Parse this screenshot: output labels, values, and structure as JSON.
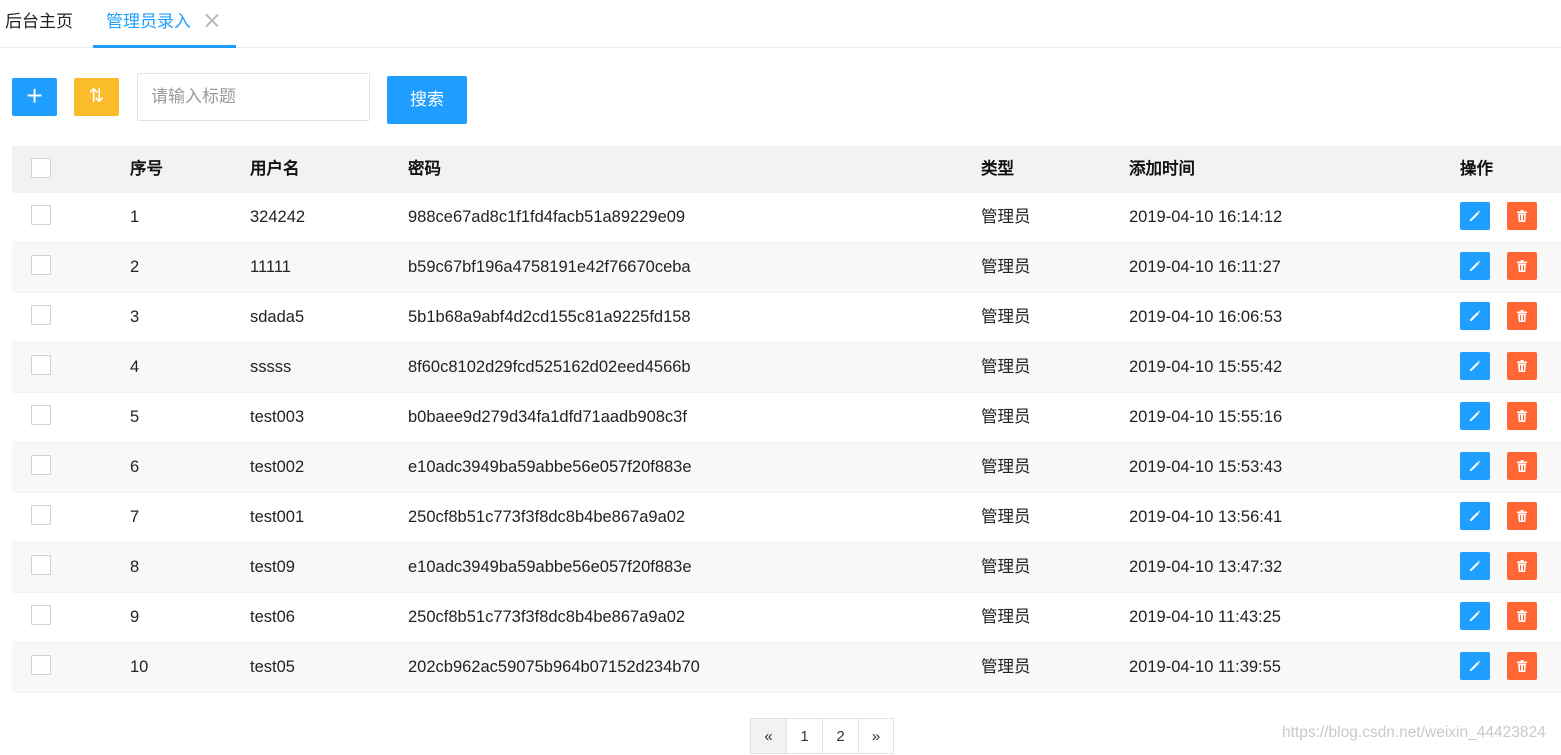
{
  "tabs": {
    "home": "后台主页",
    "active": "管理员录入"
  },
  "toolbar": {
    "add_icon": "plus-icon",
    "sort_icon": "sort-arrows-icon",
    "sort_glyph": "⇅",
    "add_glyph": "+",
    "search_placeholder": "请输入标题",
    "search_value": "",
    "search_button": "搜索"
  },
  "table": {
    "headers": {
      "id": "序号",
      "username": "用户名",
      "password": "密码",
      "type": "类型",
      "added_time": "添加时间",
      "actions": "操作"
    },
    "rows": [
      {
        "id": "1",
        "username": "324242",
        "password": "988ce67ad8c1f1fd4facb51a89229e09",
        "type": "管理员",
        "added_time": "2019-04-10 16:14:12"
      },
      {
        "id": "2",
        "username": "11111",
        "password": "b59c67bf196a4758191e42f76670ceba",
        "type": "管理员",
        "added_time": "2019-04-10 16:11:27"
      },
      {
        "id": "3",
        "username": "sdada5",
        "password": "5b1b68a9abf4d2cd155c81a9225fd158",
        "type": "管理员",
        "added_time": "2019-04-10 16:06:53"
      },
      {
        "id": "4",
        "username": "sssss",
        "password": "8f60c8102d29fcd525162d02eed4566b",
        "type": "管理员",
        "added_time": "2019-04-10 15:55:42"
      },
      {
        "id": "5",
        "username": "test003",
        "password": "b0baee9d279d34fa1dfd71aadb908c3f",
        "type": "管理员",
        "added_time": "2019-04-10 15:55:16"
      },
      {
        "id": "6",
        "username": "test002",
        "password": "e10adc3949ba59abbe56e057f20f883e",
        "type": "管理员",
        "added_time": "2019-04-10 15:53:43"
      },
      {
        "id": "7",
        "username": "test001",
        "password": "250cf8b51c773f3f8dc8b4be867a9a02",
        "type": "管理员",
        "added_time": "2019-04-10 13:56:41"
      },
      {
        "id": "8",
        "username": "test09",
        "password": "e10adc3949ba59abbe56e057f20f883e",
        "type": "管理员",
        "added_time": "2019-04-10 13:47:32"
      },
      {
        "id": "9",
        "username": "test06",
        "password": "250cf8b51c773f3f8dc8b4be867a9a02",
        "type": "管理员",
        "added_time": "2019-04-10 11:43:25"
      },
      {
        "id": "10",
        "username": "test05",
        "password": "202cb962ac59075b964b07152d234b70",
        "type": "管理员",
        "added_time": "2019-04-10 11:39:55"
      }
    ],
    "row_actions": {
      "edit_icon": "pencil-icon",
      "delete_icon": "trash-icon"
    }
  },
  "pagination": {
    "prev": "«",
    "pages": [
      "1",
      "2"
    ],
    "next": "»"
  },
  "watermark": "https://blog.csdn.net/weixin_44423824",
  "colors": {
    "primary": "#1e9fff",
    "warning": "#fbbc2c",
    "danger": "#ff6633",
    "header_bg": "#f2f2f2"
  }
}
